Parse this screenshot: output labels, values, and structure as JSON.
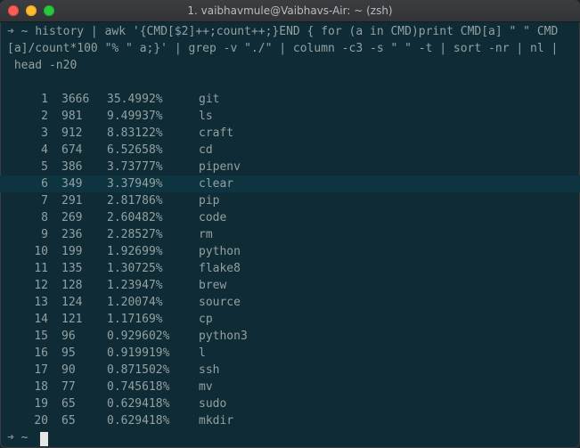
{
  "window": {
    "title": "1. vaibhavmule@Vaibhavs-Air: ~ (zsh)"
  },
  "colors": {
    "background": "#0f2b36",
    "text": "#93a1a1",
    "highlight_row": "#0d3440"
  },
  "command": {
    "arrow": "➜",
    "cwd": "~",
    "lines": [
      "history | awk '{CMD[$2]++;count++;}END { for (a in CMD)print CMD[a] \" \" CMD",
      "[a]/count*100 \"% \" a;}' | grep -v \"./\" | column -c3 -s \" \" -t | sort -nr | nl |",
      " head -n20"
    ]
  },
  "rows": [
    {
      "n": "1",
      "count": "3666",
      "pct": "35.4992%",
      "cmd": "git"
    },
    {
      "n": "2",
      "count": "981",
      "pct": "9.49937%",
      "cmd": "ls"
    },
    {
      "n": "3",
      "count": "912",
      "pct": "8.83122%",
      "cmd": "craft"
    },
    {
      "n": "4",
      "count": "674",
      "pct": "6.52658%",
      "cmd": "cd"
    },
    {
      "n": "5",
      "count": "386",
      "pct": "3.73777%",
      "cmd": "pipenv"
    },
    {
      "n": "6",
      "count": "349",
      "pct": "3.37949%",
      "cmd": "clear"
    },
    {
      "n": "7",
      "count": "291",
      "pct": "2.81786%",
      "cmd": "pip"
    },
    {
      "n": "8",
      "count": "269",
      "pct": "2.60482%",
      "cmd": "code"
    },
    {
      "n": "9",
      "count": "236",
      "pct": "2.28527%",
      "cmd": "rm"
    },
    {
      "n": "10",
      "count": "199",
      "pct": "1.92699%",
      "cmd": "python"
    },
    {
      "n": "11",
      "count": "135",
      "pct": "1.30725%",
      "cmd": "flake8"
    },
    {
      "n": "12",
      "count": "128",
      "pct": "1.23947%",
      "cmd": "brew"
    },
    {
      "n": "13",
      "count": "124",
      "pct": "1.20074%",
      "cmd": "source"
    },
    {
      "n": "14",
      "count": "121",
      "pct": "1.17169%",
      "cmd": "cp"
    },
    {
      "n": "15",
      "count": "96",
      "pct": "0.929602%",
      "cmd": "python3"
    },
    {
      "n": "16",
      "count": "95",
      "pct": "0.919919%",
      "cmd": "l"
    },
    {
      "n": "17",
      "count": "90",
      "pct": "0.871502%",
      "cmd": "ssh"
    },
    {
      "n": "18",
      "count": "77",
      "pct": "0.745618%",
      "cmd": "mv"
    },
    {
      "n": "19",
      "count": "65",
      "pct": "0.629418%",
      "cmd": "sudo"
    },
    {
      "n": "20",
      "count": "65",
      "pct": "0.629418%",
      "cmd": "mkdir"
    }
  ],
  "highlighted_row": 6,
  "prompt": {
    "arrow": "➜",
    "cwd": "~"
  }
}
